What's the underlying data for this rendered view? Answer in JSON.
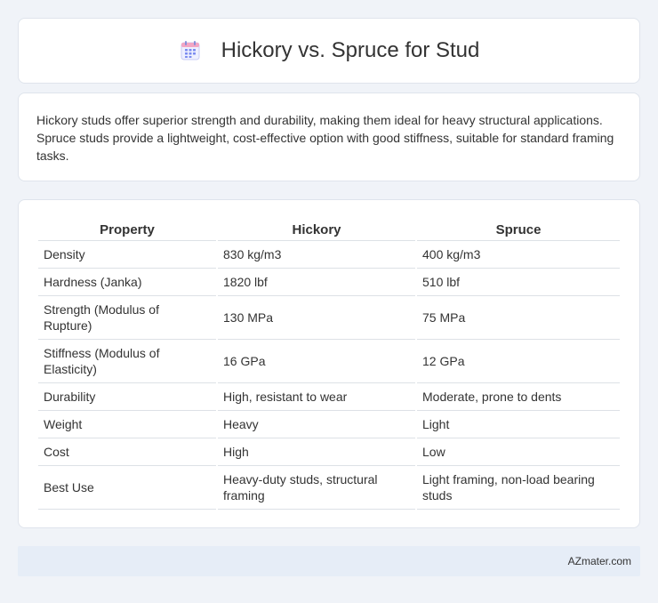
{
  "header": {
    "title": "Hickory vs. Spruce for Stud",
    "icon": "calendar-icon"
  },
  "description": "Hickory studs offer superior strength and durability, making them ideal for heavy structural applications. Spruce studs provide a lightweight, cost-effective option with good stiffness, suitable for standard framing tasks.",
  "table": {
    "headers": [
      "Property",
      "Hickory",
      "Spruce"
    ],
    "rows": [
      [
        "Density",
        "830 kg/m3",
        "400 kg/m3"
      ],
      [
        "Hardness (Janka)",
        "1820 lbf",
        "510 lbf"
      ],
      [
        "Strength (Modulus of Rupture)",
        "130 MPa",
        "75 MPa"
      ],
      [
        "Stiffness (Modulus of Elasticity)",
        "16 GPa",
        "12 GPa"
      ],
      [
        "Durability",
        "High, resistant to wear",
        "Moderate, prone to dents"
      ],
      [
        "Weight",
        "Heavy",
        "Light"
      ],
      [
        "Cost",
        "High",
        "Low"
      ],
      [
        "Best Use",
        "Heavy-duty studs, structural framing",
        "Light framing, non-load bearing studs"
      ]
    ]
  },
  "footer": {
    "site": "AZmater.com"
  },
  "colors": {
    "background": "#f0f3f8",
    "card": "#ffffff",
    "footer": "#e6edf7",
    "icon_accent": "#6c8cff"
  }
}
